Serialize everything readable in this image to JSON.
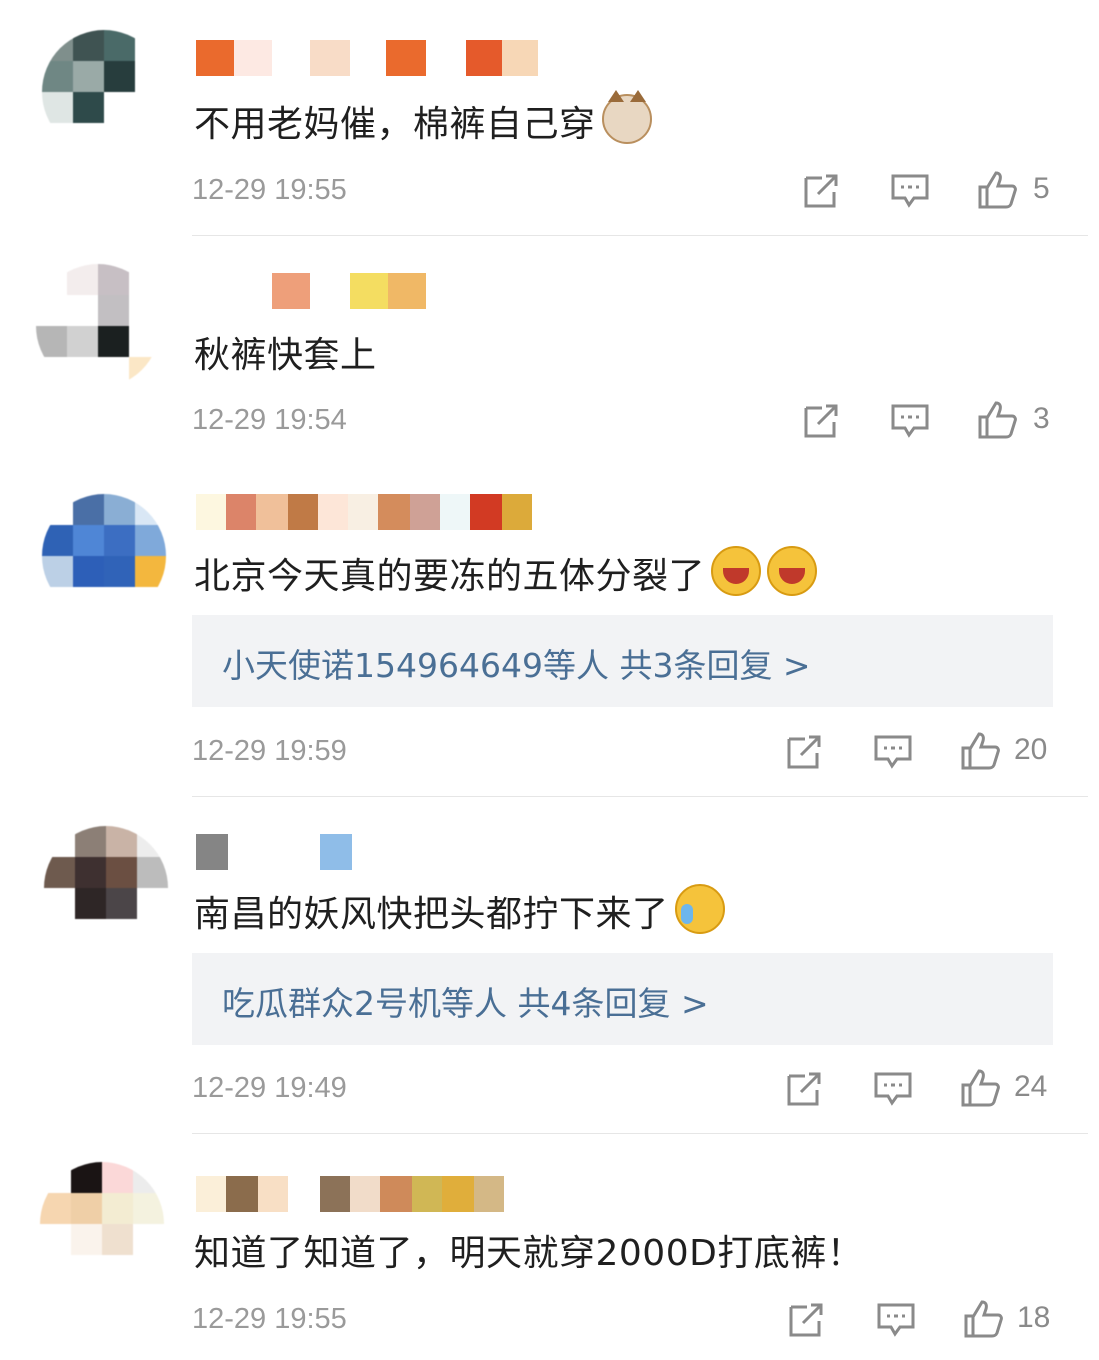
{
  "comments": [
    {
      "text": "不用老妈催，棉裤自己穿",
      "emoji": [
        "cat-face-emoji"
      ],
      "time": "12-29 19:55",
      "likes": "5",
      "replies": null
    },
    {
      "text": "秋裤快套上",
      "emoji": [],
      "time": "12-29 19:54",
      "likes": "3",
      "replies": null
    },
    {
      "text": "北京今天真的要冻的五体分裂了",
      "emoji": [
        "laughing-emoji",
        "laughing-emoji"
      ],
      "time": "12-29 19:59",
      "likes": "20",
      "replies": "小天使诺154964649等人  共3条回复 >"
    },
    {
      "text": "南昌的妖风快把头都拧下来了",
      "emoji": [
        "crying-laughing-emoji"
      ],
      "time": "12-29 19:49",
      "likes": "24",
      "replies": "吃瓜群众2号机等人  共4条回复 >"
    },
    {
      "text": "知道了知道了，明天就穿2000D打底裤！",
      "emoji": [],
      "time": "12-29 19:55",
      "likes": "18",
      "replies": null
    }
  ],
  "icons": {
    "share": "share-icon",
    "comment": "comment-icon",
    "like": "thumbs-up-icon"
  },
  "colors": {
    "reply_link": "#4a6f95",
    "meta_gray": "#9a9a9a",
    "reply_bg": "#f2f3f5"
  }
}
